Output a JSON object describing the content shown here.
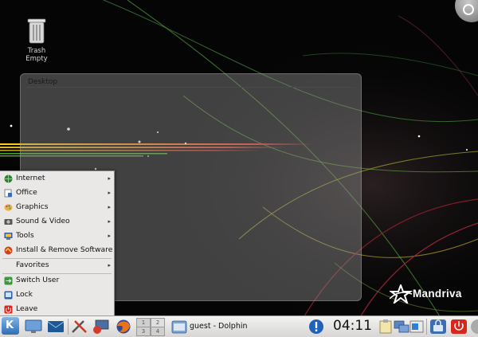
{
  "desktop": {
    "trash": {
      "label_line1": "Trash",
      "label_line2": "Empty"
    },
    "folderview": {
      "title": "Desktop"
    },
    "brand": {
      "name": "Mandriva"
    }
  },
  "menu": {
    "items": [
      {
        "label": "Internet",
        "icon": "globe-icon",
        "submenu": true
      },
      {
        "label": "Office",
        "icon": "office-icon",
        "submenu": true
      },
      {
        "label": "Graphics",
        "icon": "palette-icon",
        "submenu": true
      },
      {
        "label": "Sound & Video",
        "icon": "multimedia-icon",
        "submenu": true
      },
      {
        "label": "Tools",
        "icon": "tools-icon",
        "submenu": true
      },
      {
        "label": "Install & Remove Software",
        "icon": "package-icon",
        "submenu": false
      },
      {
        "label": "Favorites",
        "icon": "",
        "submenu": true
      },
      {
        "label": "Switch User",
        "icon": "switch-user-icon",
        "submenu": false
      },
      {
        "label": "Lock",
        "icon": "lock-icon",
        "submenu": false
      },
      {
        "label": "Leave",
        "icon": "power-icon",
        "submenu": false
      }
    ],
    "arrow": "▸"
  },
  "taskbar": {
    "kickoff_label": "K",
    "pager": [
      "1",
      "2",
      "3",
      "4"
    ],
    "task": {
      "label": "guest - Dolphin"
    },
    "clock": "04:11"
  },
  "colors": {
    "menu_bg": "#e9e8e6",
    "taskbar_bg": "#e4e3e1",
    "kde_blue": "#2d6fb5",
    "leave_red": "#d9261c"
  }
}
